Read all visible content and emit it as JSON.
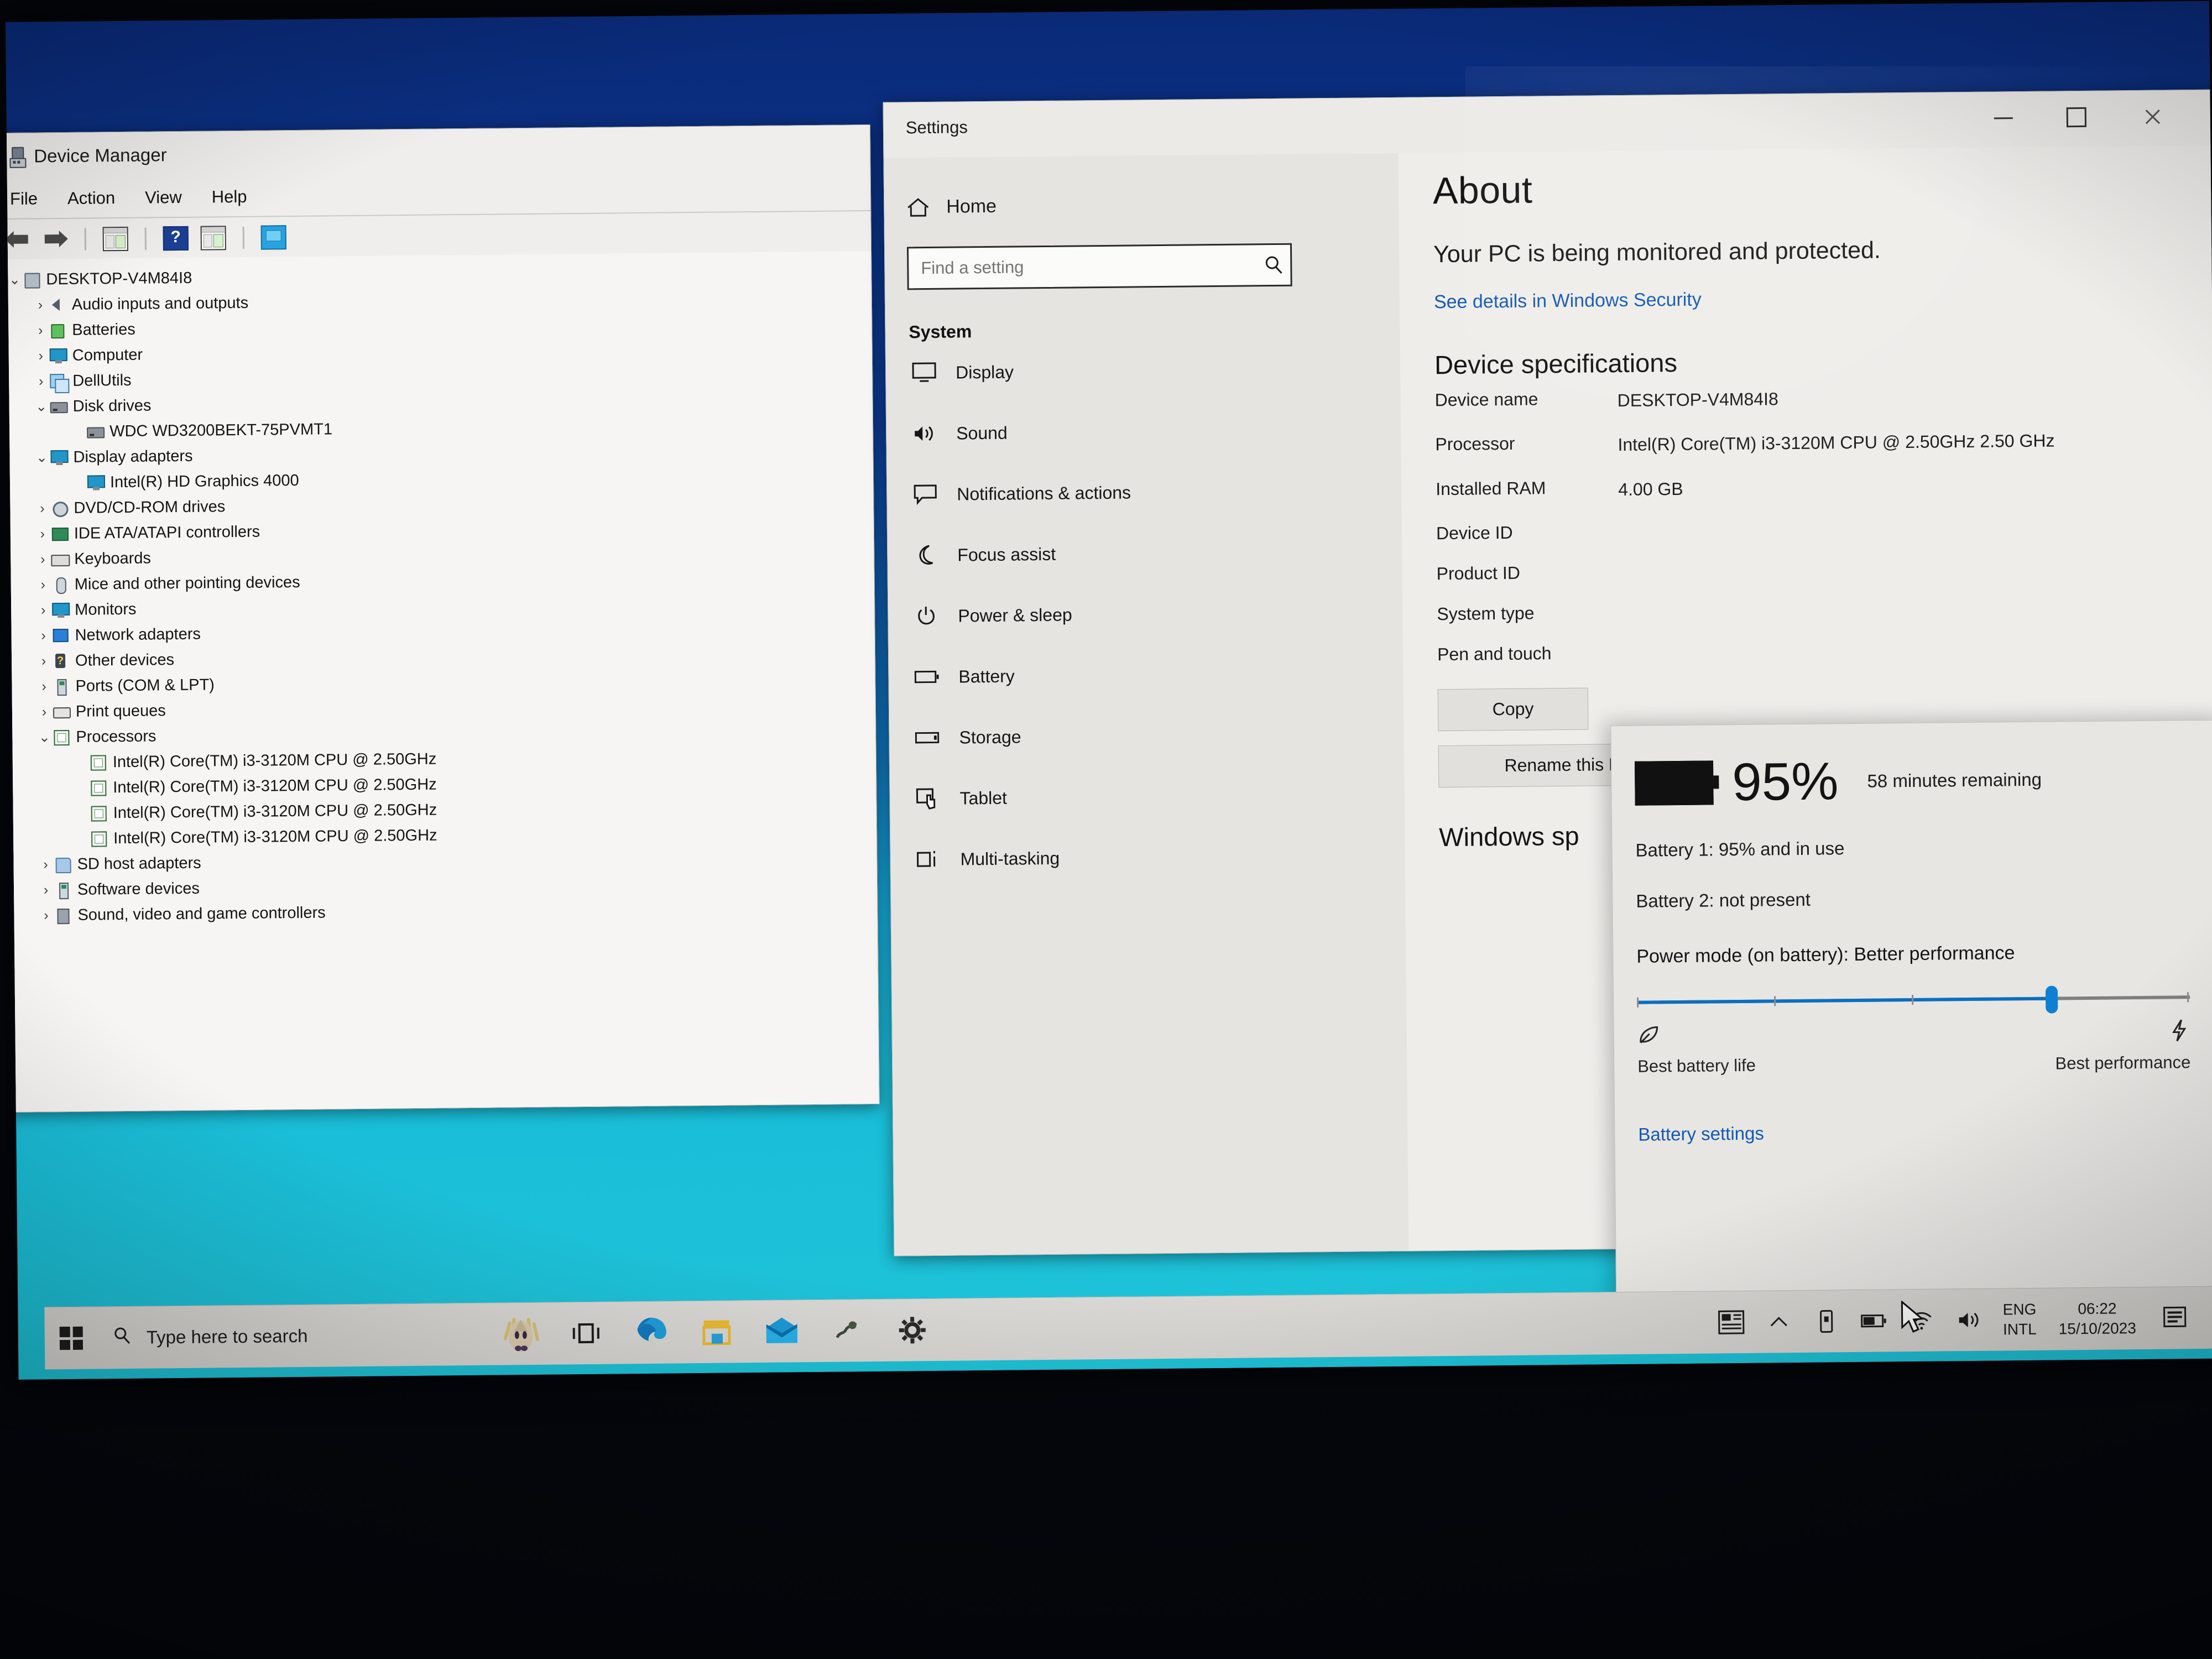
{
  "device_manager": {
    "title": "Device Manager",
    "menu": [
      "File",
      "Action",
      "View",
      "Help"
    ],
    "toolbar_icons": [
      "back-arrow-icon",
      "forward-arrow-icon",
      "properties-icon",
      "help-icon",
      "update-driver-icon",
      "scan-hardware-icon"
    ],
    "tree": [
      {
        "label": "DESKTOP-V4M84I8",
        "level": 1,
        "state": "expanded",
        "icon": "computer-icon"
      },
      {
        "label": "Audio inputs and outputs",
        "level": 2,
        "state": "collapsed",
        "icon": "speaker-icon"
      },
      {
        "label": "Batteries",
        "level": 2,
        "state": "collapsed",
        "icon": "battery-icon"
      },
      {
        "label": "Computer",
        "level": 2,
        "state": "collapsed",
        "icon": "monitor-icon"
      },
      {
        "label": "DellUtils",
        "level": 2,
        "state": "collapsed",
        "icon": "dell-icon"
      },
      {
        "label": "Disk drives",
        "level": 2,
        "state": "expanded",
        "icon": "disk-icon"
      },
      {
        "label": "WDC WD3200BEKT-75PVMT1",
        "level": 3,
        "state": "leaf",
        "icon": "disk-icon"
      },
      {
        "label": "Display adapters",
        "level": 2,
        "state": "expanded",
        "icon": "display-icon"
      },
      {
        "label": "Intel(R) HD Graphics 4000",
        "level": 3,
        "state": "leaf",
        "icon": "display-icon"
      },
      {
        "label": "DVD/CD-ROM drives",
        "level": 2,
        "state": "collapsed",
        "icon": "dvd-icon"
      },
      {
        "label": "IDE ATA/ATAPI controllers",
        "level": 2,
        "state": "collapsed",
        "icon": "ide-icon"
      },
      {
        "label": "Keyboards",
        "level": 2,
        "state": "collapsed",
        "icon": "keyboard-icon"
      },
      {
        "label": "Mice and other pointing devices",
        "level": 2,
        "state": "collapsed",
        "icon": "mouse-icon"
      },
      {
        "label": "Monitors",
        "level": 2,
        "state": "collapsed",
        "icon": "monitor-icon"
      },
      {
        "label": "Network adapters",
        "level": 2,
        "state": "collapsed",
        "icon": "network-icon"
      },
      {
        "label": "Other devices",
        "level": 2,
        "state": "collapsed",
        "icon": "unknown-device-icon"
      },
      {
        "label": "Ports (COM & LPT)",
        "level": 2,
        "state": "collapsed",
        "icon": "port-icon"
      },
      {
        "label": "Print queues",
        "level": 2,
        "state": "collapsed",
        "icon": "printer-icon"
      },
      {
        "label": "Processors",
        "level": 2,
        "state": "expanded",
        "icon": "processor-icon"
      },
      {
        "label": "Intel(R) Core(TM) i3-3120M CPU @ 2.50GHz",
        "level": 3,
        "state": "leaf",
        "icon": "processor-icon"
      },
      {
        "label": "Intel(R) Core(TM) i3-3120M CPU @ 2.50GHz",
        "level": 3,
        "state": "leaf",
        "icon": "processor-icon"
      },
      {
        "label": "Intel(R) Core(TM) i3-3120M CPU @ 2.50GHz",
        "level": 3,
        "state": "leaf",
        "icon": "processor-icon"
      },
      {
        "label": "Intel(R) Core(TM) i3-3120M CPU @ 2.50GHz",
        "level": 3,
        "state": "leaf",
        "icon": "processor-icon"
      },
      {
        "label": "SD host adapters",
        "level": 2,
        "state": "collapsed",
        "icon": "sd-card-icon"
      },
      {
        "label": "Software devices",
        "level": 2,
        "state": "collapsed",
        "icon": "software-device-icon"
      },
      {
        "label": "Sound, video and game controllers",
        "level": 2,
        "state": "collapsed",
        "icon": "sound-controller-icon"
      }
    ]
  },
  "settings": {
    "window_title": "Settings",
    "window_controls": {
      "minimize": "minimize-icon",
      "maximize": "maximize-icon",
      "close": "close-icon"
    },
    "home_label": "Home",
    "search": {
      "placeholder": "Find a setting",
      "value": ""
    },
    "section_header": "System",
    "nav_items": [
      {
        "label": "Display",
        "icon": "display-icon"
      },
      {
        "label": "Sound",
        "icon": "sound-icon"
      },
      {
        "label": "Notifications & actions",
        "icon": "notification-icon"
      },
      {
        "label": "Focus assist",
        "icon": "moon-icon"
      },
      {
        "label": "Power & sleep",
        "icon": "power-icon"
      },
      {
        "label": "Battery",
        "icon": "battery-icon"
      },
      {
        "label": "Storage",
        "icon": "storage-icon"
      },
      {
        "label": "Tablet",
        "icon": "tablet-icon"
      },
      {
        "label": "Multi-tasking",
        "icon": "multitasking-icon"
      }
    ],
    "about": {
      "heading": "About",
      "protection_status": "Your PC is being monitored and protected.",
      "security_link": "See details in Windows Security",
      "device_spec_heading": "Device specifications",
      "specs": [
        {
          "key": "Device name",
          "value": "DESKTOP-V4M84I8"
        },
        {
          "key": "Processor",
          "value": "Intel(R) Core(TM) i3-3120M CPU @ 2.50GHz   2.50 GHz"
        },
        {
          "key": "Installed RAM",
          "value": "4.00 GB"
        },
        {
          "key": "Device ID",
          "value": ""
        },
        {
          "key": "Product ID",
          "value": ""
        },
        {
          "key": "System type",
          "value": ""
        },
        {
          "key": "Pen and touch",
          "value": ""
        }
      ],
      "copy_button": "Copy",
      "rename_button": "Rename this PC",
      "windows_spec_heading": "Windows sp"
    }
  },
  "battery_flyout": {
    "icon": "battery-full-icon",
    "percent": "95%",
    "remaining": "58 minutes remaining",
    "battery1": "Battery 1: 95% and in use",
    "battery2": "Battery 2: not present",
    "power_mode_label": "Power mode (on battery): Better performance",
    "slider": {
      "value": 75,
      "left_label": "Best battery life",
      "right_label": "Best performance",
      "left_icon": "leaf-icon",
      "right_icon": "lightning-icon"
    },
    "settings_link": "Battery settings"
  },
  "taskbar": {
    "start_icon": "windows-logo-icon",
    "search_placeholder": "Type here to search",
    "search_icon": "search-icon",
    "pinned": [
      {
        "name": "cortana-hedgehog-icon"
      },
      {
        "name": "task-view-icon"
      },
      {
        "name": "edge-browser-icon"
      },
      {
        "name": "microsoft-store-icon"
      },
      {
        "name": "mail-icon"
      },
      {
        "name": "photos-icon"
      },
      {
        "name": "settings-gear-icon"
      }
    ],
    "tray": {
      "news_icon": "news-and-interests-icon",
      "chevron_icon": "show-hidden-icons-icon",
      "onedrive_icon": "onedrive-icon",
      "battery_icon": "battery-tray-icon",
      "wifi_icon": "wifi-icon",
      "volume_icon": "volume-icon",
      "language_line1": "ENG",
      "language_line2": "INTL",
      "time": "06:22",
      "date": "15/10/2023",
      "action_center_icon": "action-center-icon"
    }
  },
  "colors": {
    "accent_blue": "#0f7fd4",
    "link_blue": "#1359b5",
    "taskbar_bg": "#d9d7d3",
    "window_bg": "#efedea",
    "wallpaper_teal": "#19bdd8"
  }
}
